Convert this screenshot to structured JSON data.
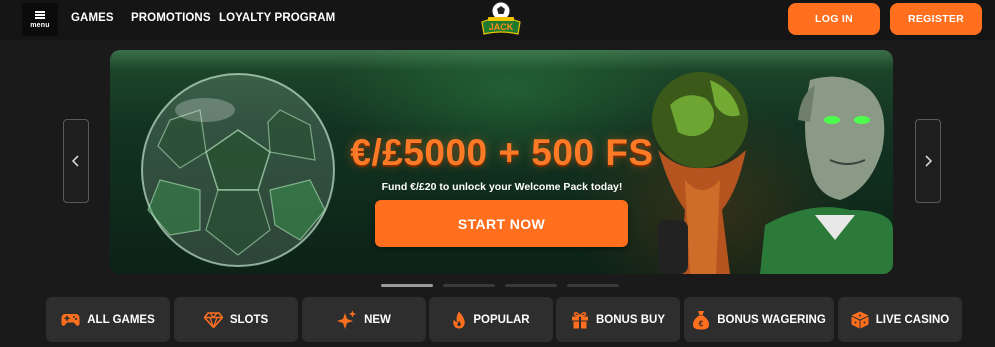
{
  "header": {
    "menu_label": "menu",
    "nav": [
      "GAMES",
      "PROMOTIONS",
      "LOYALTY PROGRAM"
    ],
    "login_label": "LOG IN",
    "register_label": "REGISTER",
    "logo_text": "Football JACKS"
  },
  "banner": {
    "headline": "€/£5000 + 500 FS",
    "subline": "Fund €/£20 to unlock your Welcome Pack today!",
    "cta_label": "START NOW",
    "slides_total": 4,
    "active_slide": 1
  },
  "categories": [
    {
      "label": "ALL GAMES",
      "icon": "gamepad-icon"
    },
    {
      "label": "SLOTS",
      "icon": "diamond-icon"
    },
    {
      "label": "NEW",
      "icon": "sparkles-icon"
    },
    {
      "label": "POPULAR",
      "icon": "flame-icon"
    },
    {
      "label": "BONUS BUY",
      "icon": "gift-icon"
    },
    {
      "label": "BONUS WAGERING",
      "icon": "money-bag-icon"
    },
    {
      "label": "LIVE CASINO",
      "icon": "cube-icon"
    }
  ],
  "colors": {
    "accent": "#ff6f1e",
    "background": "#1a1a1a",
    "tile": "#2e2e2e",
    "headline": "#ff7a26"
  }
}
